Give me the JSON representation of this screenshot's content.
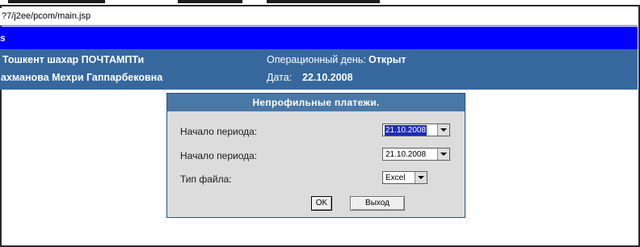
{
  "browser": {
    "url": "?7/j2ee/pcom/main.jsp"
  },
  "header": {
    "blue_bar_text": "s",
    "office_name": "Тошкент шахар ПОЧТАМПТи",
    "operator_name": "ахманова Мехри Гаппарбековна",
    "op_day_label": "Операционный день:",
    "op_day_value": "Открыт",
    "date_label": "Дата:",
    "date_value": "22.10.2008"
  },
  "dialog": {
    "title": "Непрофильные платежи.",
    "fields": [
      {
        "label": "Начало периода:",
        "value": "21.10.2008",
        "selected": true
      },
      {
        "label": "Начало периода:",
        "value": "21.10.2008",
        "selected": false
      },
      {
        "label": "Тип файла:",
        "value": "Excel",
        "selected": false
      }
    ],
    "ok_label": "OK",
    "exit_label": "Выход"
  },
  "colors": {
    "blue_bar": "#0000ff",
    "info_band": "#36689e",
    "dialog_title": "#4a78a6",
    "dialog_body": "#dcdcdc",
    "selection": "#1e2bb8"
  },
  "icons": {
    "combo_arrow": "chevron-down-icon"
  }
}
